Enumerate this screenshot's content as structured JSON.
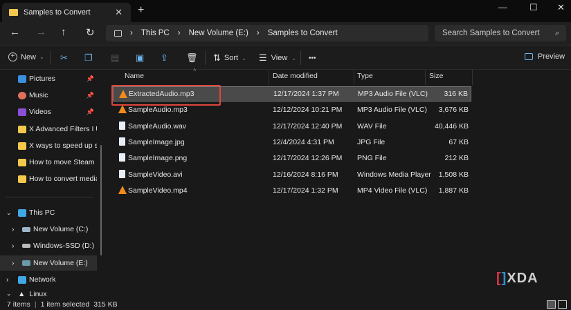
{
  "window": {
    "tab_title": "Samples to Convert",
    "new_tab": "+",
    "minimize": "—",
    "maximize": "☐",
    "close": "✕"
  },
  "nav": {
    "back": "←",
    "forward": "→",
    "up": "↑",
    "refresh": "↻"
  },
  "breadcrumb": [
    "This PC",
    "New Volume (E:)",
    "Samples to Convert"
  ],
  "search": {
    "placeholder": "Search Samples to Convert"
  },
  "toolbar": {
    "new": "New",
    "sort": "Sort",
    "view": "View",
    "more": "•••",
    "preview": "Preview"
  },
  "sidebar": {
    "quick": [
      {
        "label": "Pictures",
        "icon": "pictures-icon",
        "color": "#3b8fe0",
        "pinned": true
      },
      {
        "label": "Music",
        "icon": "music-icon",
        "color": "#e0705a",
        "pinned": true
      },
      {
        "label": "Videos",
        "icon": "videos-icon",
        "color": "#8a4fd6",
        "pinned": true
      },
      {
        "label": "X Advanced Filters I Use",
        "icon": "folder-icon",
        "color": "#f2c94c"
      },
      {
        "label": "X ways to speed up slow",
        "icon": "folder-icon",
        "color": "#f2c94c"
      },
      {
        "label": "How to move Steam gan",
        "icon": "folder-icon",
        "color": "#f2c94c"
      },
      {
        "label": "How to convert media fil",
        "icon": "folder-icon",
        "color": "#f2c94c"
      }
    ],
    "this_pc": "This PC",
    "drives": [
      "New Volume (C:)",
      "Windows-SSD (D:)",
      "New Volume (E:)"
    ],
    "network": "Network",
    "linux": "Linux"
  },
  "columns": {
    "name": "Name",
    "date": "Date modified",
    "type": "Type",
    "size": "Size"
  },
  "files": [
    {
      "name": "ExtractedAudio.mp3",
      "date": "12/17/2024 1:37 PM",
      "type": "MP3 Audio File (VLC)",
      "size": "316 KB",
      "icon": "vlc-icon",
      "selected": true
    },
    {
      "name": "SampleAudio.mp3",
      "date": "12/12/2024 10:21 PM",
      "type": "MP3 Audio File (VLC)",
      "size": "3,676 KB",
      "icon": "vlc-icon"
    },
    {
      "name": "SampleAudio.wav",
      "date": "12/17/2024 12:40 PM",
      "type": "WAV File",
      "size": "40,446 KB",
      "icon": "audio-file-icon"
    },
    {
      "name": "SampleImage.jpg",
      "date": "12/4/2024 4:31 PM",
      "type": "JPG File",
      "size": "67 KB",
      "icon": "image-file-icon"
    },
    {
      "name": "SampleImage.png",
      "date": "12/17/2024 12:26 PM",
      "type": "PNG File",
      "size": "212 KB",
      "icon": "image-file-icon"
    },
    {
      "name": "SampleVideo.avi",
      "date": "12/16/2024 8:16 PM",
      "type": "Windows Media Player",
      "size": "1,508 KB",
      "icon": "video-file-icon"
    },
    {
      "name": "SampleVideo.mp4",
      "date": "12/17/2024 1:32 PM",
      "type": "MP4 Video File (VLC)",
      "size": "1,887 KB",
      "icon": "vlc-icon"
    }
  ],
  "status": {
    "items": "7 items",
    "selected": "1 item selected",
    "size": "315 KB"
  },
  "watermark": "XDA",
  "colors": {
    "highlight": "#e0453b",
    "vlc": "#f08a1c"
  }
}
